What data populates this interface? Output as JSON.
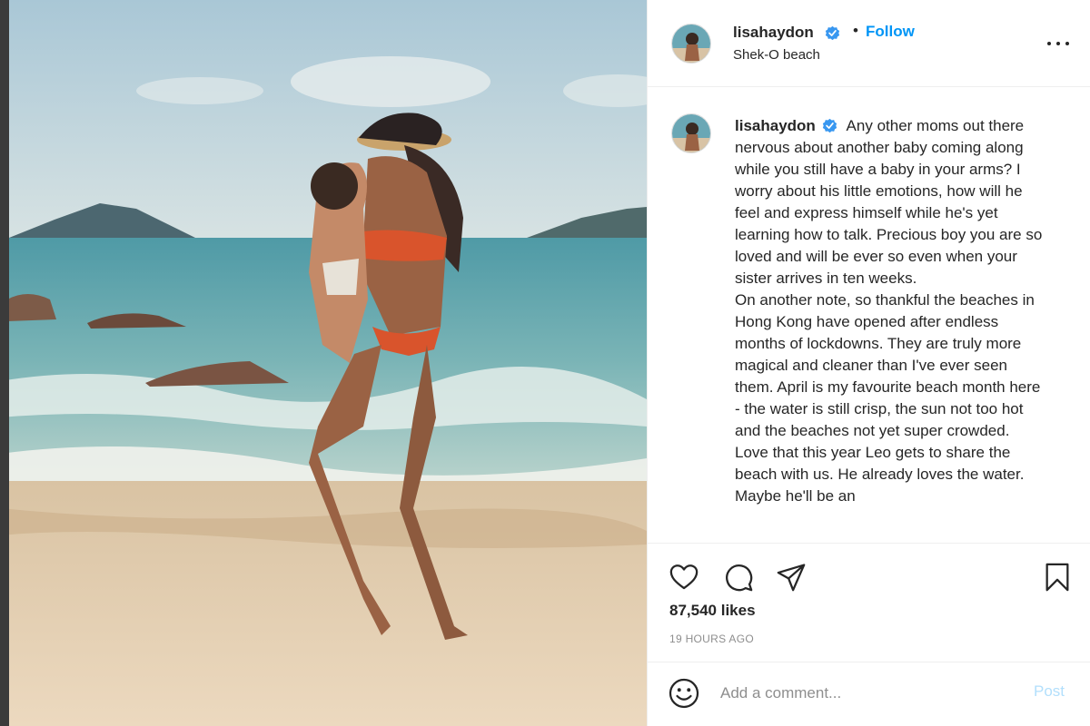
{
  "post": {
    "username": "lisahaydon",
    "follow_label": "Follow",
    "separator": "•",
    "location": "Shek-O beach",
    "caption": "Any other moms out there nervous about another baby coming along while you still have a baby in your arms? I worry about his little emotions, how will he feel and express himself while he's yet learning how to talk. Precious boy you are so loved and will be ever so even when your sister arrives in ten weeks.\nOn another note, so thankful the beaches in Hong Kong have opened after endless months of lockdowns. They are truly more magical and cleaner than I've ever seen them. April is my favourite beach month here - the water is still crisp, the sun not too hot and the beaches not yet super crowded. Love that this year Leo gets to share the beach with us. He already loves the water. Maybe he'll be an",
    "likes": "87,540 likes",
    "timestamp": "19 HOURS AGO"
  },
  "comment_box": {
    "placeholder": "Add a comment...",
    "post_label": "Post"
  },
  "icons": {
    "verified": "verified-badge-icon",
    "more": "more-options-icon",
    "like": "heart-icon",
    "comment": "comment-bubble-icon",
    "share": "paper-plane-icon",
    "save": "bookmark-icon",
    "emoji": "smiley-icon"
  },
  "colors": {
    "accent": "#0095f6",
    "post_disabled": "#b2dffc",
    "text": "#262626",
    "muted": "#8e8e8e",
    "verified": "#3897f0"
  }
}
